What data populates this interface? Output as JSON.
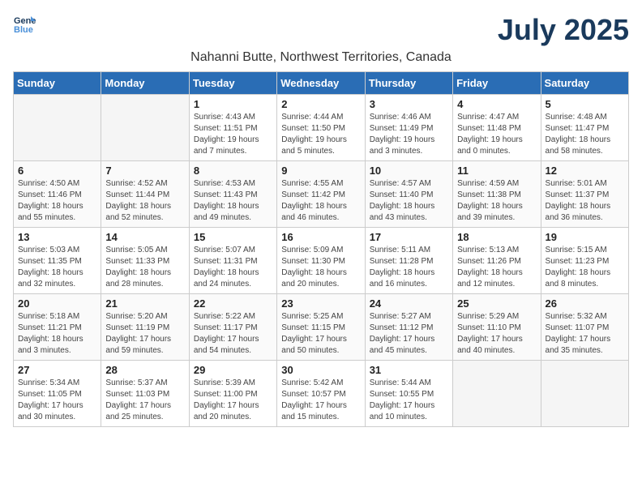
{
  "header": {
    "logo_line1": "General",
    "logo_line2": "Blue",
    "title": "July 2025",
    "location": "Nahanni Butte, Northwest Territories, Canada"
  },
  "weekdays": [
    "Sunday",
    "Monday",
    "Tuesday",
    "Wednesday",
    "Thursday",
    "Friday",
    "Saturday"
  ],
  "weeks": [
    [
      {
        "day": "",
        "info": ""
      },
      {
        "day": "",
        "info": ""
      },
      {
        "day": "1",
        "info": "Sunrise: 4:43 AM\nSunset: 11:51 PM\nDaylight: 19 hours\nand 7 minutes."
      },
      {
        "day": "2",
        "info": "Sunrise: 4:44 AM\nSunset: 11:50 PM\nDaylight: 19 hours\nand 5 minutes."
      },
      {
        "day": "3",
        "info": "Sunrise: 4:46 AM\nSunset: 11:49 PM\nDaylight: 19 hours\nand 3 minutes."
      },
      {
        "day": "4",
        "info": "Sunrise: 4:47 AM\nSunset: 11:48 PM\nDaylight: 19 hours\nand 0 minutes."
      },
      {
        "day": "5",
        "info": "Sunrise: 4:48 AM\nSunset: 11:47 PM\nDaylight: 18 hours\nand 58 minutes."
      }
    ],
    [
      {
        "day": "6",
        "info": "Sunrise: 4:50 AM\nSunset: 11:46 PM\nDaylight: 18 hours\nand 55 minutes."
      },
      {
        "day": "7",
        "info": "Sunrise: 4:52 AM\nSunset: 11:44 PM\nDaylight: 18 hours\nand 52 minutes."
      },
      {
        "day": "8",
        "info": "Sunrise: 4:53 AM\nSunset: 11:43 PM\nDaylight: 18 hours\nand 49 minutes."
      },
      {
        "day": "9",
        "info": "Sunrise: 4:55 AM\nSunset: 11:42 PM\nDaylight: 18 hours\nand 46 minutes."
      },
      {
        "day": "10",
        "info": "Sunrise: 4:57 AM\nSunset: 11:40 PM\nDaylight: 18 hours\nand 43 minutes."
      },
      {
        "day": "11",
        "info": "Sunrise: 4:59 AM\nSunset: 11:38 PM\nDaylight: 18 hours\nand 39 minutes."
      },
      {
        "day": "12",
        "info": "Sunrise: 5:01 AM\nSunset: 11:37 PM\nDaylight: 18 hours\nand 36 minutes."
      }
    ],
    [
      {
        "day": "13",
        "info": "Sunrise: 5:03 AM\nSunset: 11:35 PM\nDaylight: 18 hours\nand 32 minutes."
      },
      {
        "day": "14",
        "info": "Sunrise: 5:05 AM\nSunset: 11:33 PM\nDaylight: 18 hours\nand 28 minutes."
      },
      {
        "day": "15",
        "info": "Sunrise: 5:07 AM\nSunset: 11:31 PM\nDaylight: 18 hours\nand 24 minutes."
      },
      {
        "day": "16",
        "info": "Sunrise: 5:09 AM\nSunset: 11:30 PM\nDaylight: 18 hours\nand 20 minutes."
      },
      {
        "day": "17",
        "info": "Sunrise: 5:11 AM\nSunset: 11:28 PM\nDaylight: 18 hours\nand 16 minutes."
      },
      {
        "day": "18",
        "info": "Sunrise: 5:13 AM\nSunset: 11:26 PM\nDaylight: 18 hours\nand 12 minutes."
      },
      {
        "day": "19",
        "info": "Sunrise: 5:15 AM\nSunset: 11:23 PM\nDaylight: 18 hours\nand 8 minutes."
      }
    ],
    [
      {
        "day": "20",
        "info": "Sunrise: 5:18 AM\nSunset: 11:21 PM\nDaylight: 18 hours\nand 3 minutes."
      },
      {
        "day": "21",
        "info": "Sunrise: 5:20 AM\nSunset: 11:19 PM\nDaylight: 17 hours\nand 59 minutes."
      },
      {
        "day": "22",
        "info": "Sunrise: 5:22 AM\nSunset: 11:17 PM\nDaylight: 17 hours\nand 54 minutes."
      },
      {
        "day": "23",
        "info": "Sunrise: 5:25 AM\nSunset: 11:15 PM\nDaylight: 17 hours\nand 50 minutes."
      },
      {
        "day": "24",
        "info": "Sunrise: 5:27 AM\nSunset: 11:12 PM\nDaylight: 17 hours\nand 45 minutes."
      },
      {
        "day": "25",
        "info": "Sunrise: 5:29 AM\nSunset: 11:10 PM\nDaylight: 17 hours\nand 40 minutes."
      },
      {
        "day": "26",
        "info": "Sunrise: 5:32 AM\nSunset: 11:07 PM\nDaylight: 17 hours\nand 35 minutes."
      }
    ],
    [
      {
        "day": "27",
        "info": "Sunrise: 5:34 AM\nSunset: 11:05 PM\nDaylight: 17 hours\nand 30 minutes."
      },
      {
        "day": "28",
        "info": "Sunrise: 5:37 AM\nSunset: 11:03 PM\nDaylight: 17 hours\nand 25 minutes."
      },
      {
        "day": "29",
        "info": "Sunrise: 5:39 AM\nSunset: 11:00 PM\nDaylight: 17 hours\nand 20 minutes."
      },
      {
        "day": "30",
        "info": "Sunrise: 5:42 AM\nSunset: 10:57 PM\nDaylight: 17 hours\nand 15 minutes."
      },
      {
        "day": "31",
        "info": "Sunrise: 5:44 AM\nSunset: 10:55 PM\nDaylight: 17 hours\nand 10 minutes."
      },
      {
        "day": "",
        "info": ""
      },
      {
        "day": "",
        "info": ""
      }
    ]
  ]
}
